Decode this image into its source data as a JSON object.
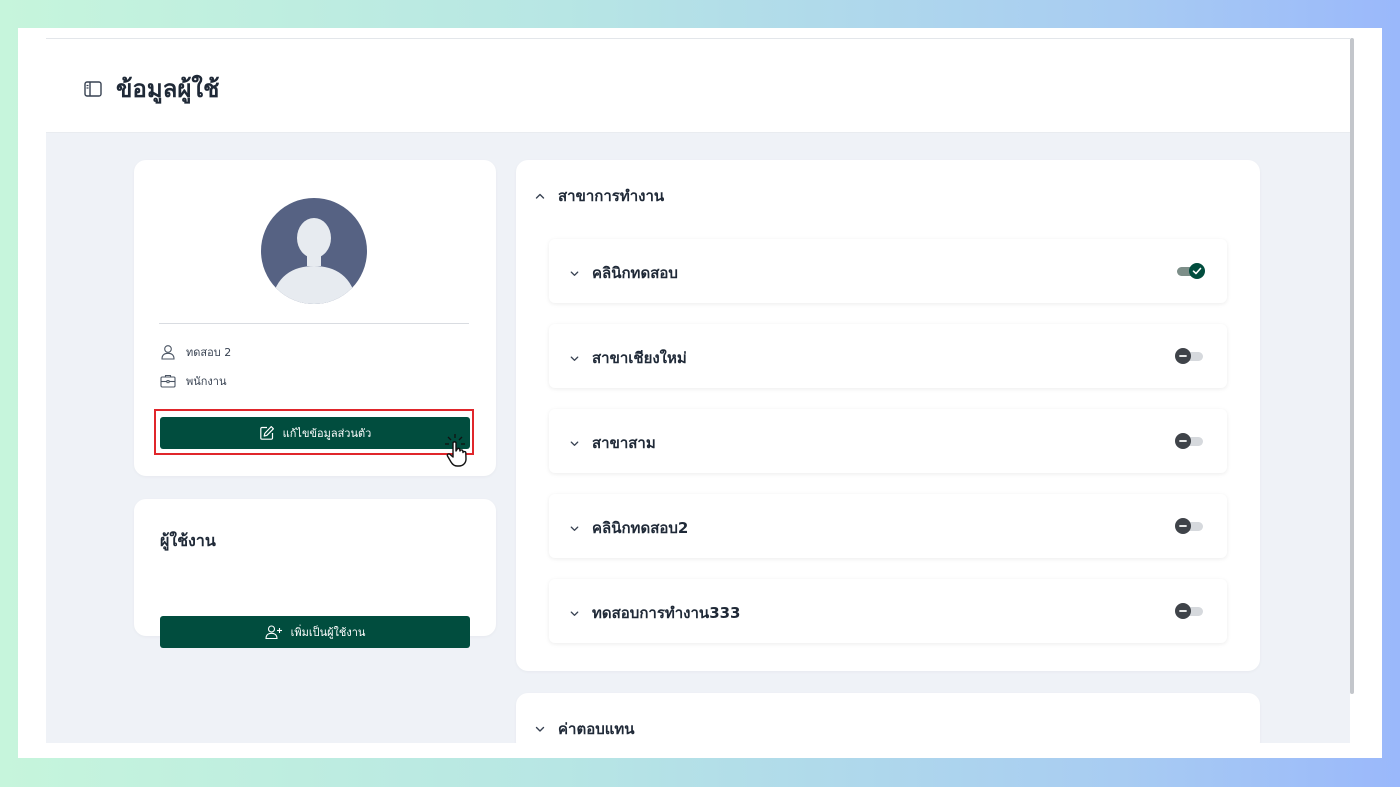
{
  "page": {
    "title": "ข้อมูลผู้ใช้",
    "title_icon": "sidebar-panel-icon"
  },
  "profile": {
    "avatar_icon": "user-avatar-placeholder",
    "name": "ทดสอบ 2",
    "name_icon": "user-icon",
    "role": "พนักงาน",
    "role_icon": "briefcase-icon",
    "edit_button": "แก้ไขข้อมูลส่วนตัว",
    "edit_icon": "edit-icon"
  },
  "user_section": {
    "title": "ผู้ใช้งาน",
    "add_button": "เพิ่มเป็นผู้ใช้งาน",
    "add_icon": "user-plus-icon"
  },
  "branches": {
    "title": "สาขาการทำงาน",
    "expanded": true,
    "items": [
      {
        "label": "คลินิกทดสอบ",
        "enabled": true
      },
      {
        "label": "สาขาเชียงใหม่",
        "enabled": false
      },
      {
        "label": "สาขาสาม",
        "enabled": false
      },
      {
        "label": "คลินิกทดสอบ2",
        "enabled": false
      },
      {
        "label": "ทดสอบการทำงาน333",
        "enabled": false
      }
    ]
  },
  "compensation": {
    "title": "ค่าตอบแทน",
    "expanded": false
  },
  "colors": {
    "primary": "#014d3e",
    "highlight": "#e0262b",
    "background": "#eff2f7"
  }
}
